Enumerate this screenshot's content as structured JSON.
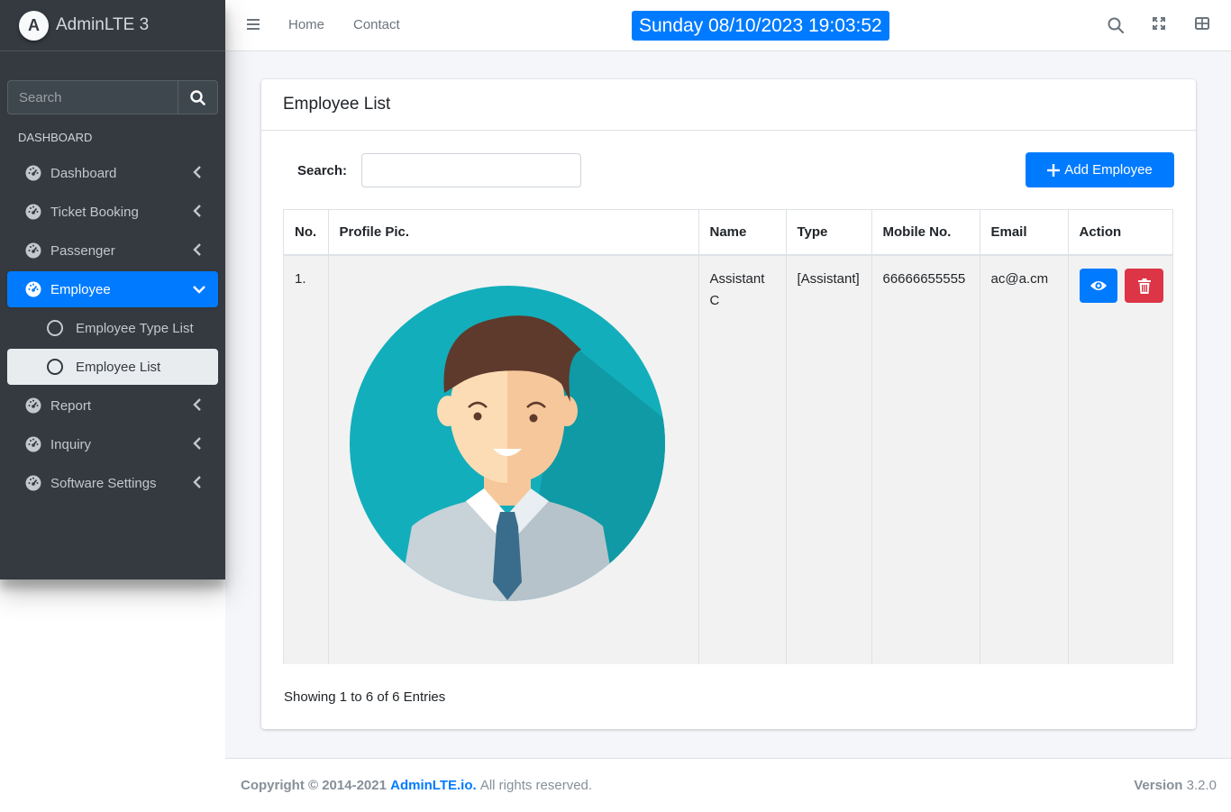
{
  "brand": {
    "logo_letter": "A",
    "name": "AdminLTE 3"
  },
  "sidebar": {
    "search_placeholder": "Search",
    "header": "DASHBOARD",
    "items": [
      {
        "label": "Dashboard"
      },
      {
        "label": "Ticket Booking"
      },
      {
        "label": "Passenger"
      },
      {
        "label": "Employee",
        "active": true
      },
      {
        "label": "Employee Type List",
        "sub": true
      },
      {
        "label": "Employee List",
        "sub": true,
        "current": true
      },
      {
        "label": "Report"
      },
      {
        "label": "Inquiry"
      },
      {
        "label": "Software Settings"
      }
    ]
  },
  "topnav": {
    "home": "Home",
    "contact": "Contact",
    "clock": "Sunday 08/10/2023 19:03:52",
    "icons": [
      "search-icon",
      "expand-icon",
      "grid-icon"
    ]
  },
  "card": {
    "title": "Employee List",
    "search_label": "Search:",
    "add_button": "Add Employee",
    "table": {
      "headers": [
        "No.",
        "Profile Pic.",
        "Name",
        "Type",
        "Mobile No.",
        "Email",
        "Action"
      ],
      "rows": [
        {
          "no": "1.",
          "name": "Assistant C",
          "type": "[Assistant]",
          "mobile": "66666655555",
          "email": "ac@a.cm"
        }
      ]
    },
    "footer_text": "Showing 1 to 6 of 6 Entries"
  },
  "footer": {
    "copyright": "Copyright © 2014-2021",
    "link": "AdminLTE.io.",
    "rights": "All rights reserved.",
    "version_label": "Version",
    "version": "3.2.0"
  },
  "colors": {
    "primary": "#007bff",
    "danger": "#dc3545",
    "sidebar": "#343a40",
    "avatar_bg": "#13aebb"
  }
}
